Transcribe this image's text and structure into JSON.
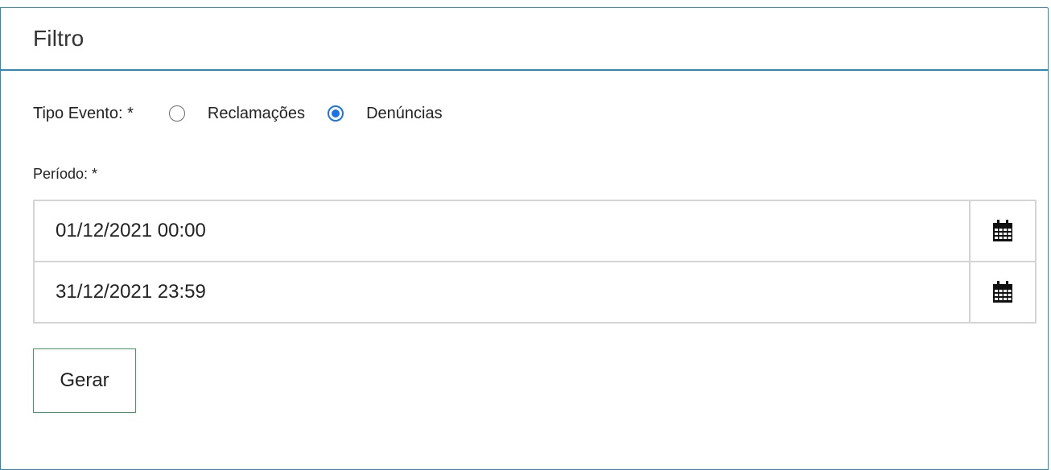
{
  "panel": {
    "title": "Filtro"
  },
  "form": {
    "tipo_evento": {
      "label": "Tipo Evento: *",
      "options": [
        {
          "label": "Reclamações",
          "checked": false
        },
        {
          "label": "Denúncias",
          "checked": true
        }
      ]
    },
    "periodo": {
      "label": "Período: *",
      "start": "01/12/2021 00:00",
      "end": "31/12/2021 23:59"
    },
    "submit_label": "Gerar"
  },
  "colors": {
    "panel_border": "#2a8ab8",
    "radio_selected": "#1a73e8",
    "button_border": "#3aa15a",
    "input_border": "#d4d4d4"
  },
  "icons": {
    "calendar": "calendar-icon"
  }
}
